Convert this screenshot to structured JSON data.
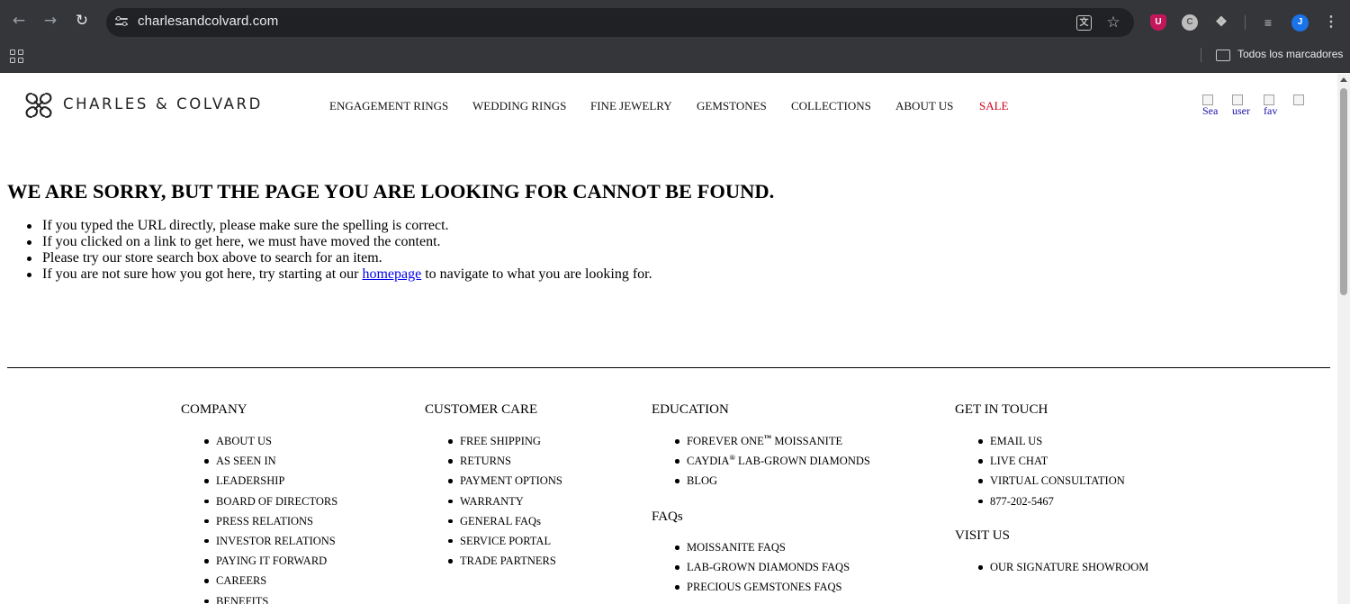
{
  "browser": {
    "url": "charlesandcolvard.com",
    "translate_glyph": "文",
    "bookmarks_folder_label": "Todos los marcadores",
    "profile_initial": "J",
    "extension_u_letter": "U",
    "extension_c_letter": "C"
  },
  "header": {
    "logo_text": "CHARLES & COLVARD",
    "nav": [
      "ENGAGEMENT RINGS",
      "WEDDING RINGS",
      "FINE JEWELRY",
      "GEMSTONES",
      "COLLECTIONS",
      "ABOUT US",
      "SALE"
    ],
    "icon_alts": [
      "Sea",
      "user",
      "fav",
      ""
    ]
  },
  "error": {
    "title": "WE ARE SORRY, BUT THE PAGE YOU ARE LOOKING FOR CANNOT BE FOUND.",
    "item_1": "If you typed the URL directly, please make sure the spelling is correct.",
    "item_2": "If you clicked on a link to get here, we must have moved the content.",
    "item_3": "Please try our store search box above to search for an item.",
    "item_4_before": "If you are not sure how you got here, try starting at our ",
    "item_4_link": "homepage",
    "item_4_after": " to navigate to what you are looking for."
  },
  "footer": {
    "company": {
      "heading": "COMPANY",
      "items": [
        "ABOUT US",
        "AS SEEN IN",
        "LEADERSHIP",
        "BOARD OF DIRECTORS",
        "PRESS RELATIONS",
        "INVESTOR RELATIONS",
        "PAYING IT FORWARD",
        "CAREERS",
        "BENEFITS"
      ]
    },
    "customer_care": {
      "heading": "CUSTOMER CARE",
      "items": [
        "FREE SHIPPING",
        "RETURNS",
        "PAYMENT OPTIONS",
        "WARRANTY",
        "GENERAL FAQs",
        "SERVICE PORTAL",
        "TRADE PARTNERS"
      ]
    },
    "education": {
      "heading": "EDUCATION",
      "forever_one_a": "FOREVER ONE",
      "forever_one_sup": "™",
      "forever_one_b": " MOISSANITE",
      "caydia_a": "CAYDIA",
      "caydia_sup": "®",
      "caydia_b": " LAB-GROWN DIAMONDS",
      "blog": "BLOG"
    },
    "faqs": {
      "heading": "FAQs",
      "items": [
        "MOISSANITE FAQS",
        "LAB-GROWN DIAMONDS FAQS",
        "PRECIOUS GEMSTONES FAQS"
      ]
    },
    "get_in_touch": {
      "heading": "GET IN TOUCH",
      "items": [
        "EMAIL US",
        "LIVE CHAT",
        "VIRTUAL CONSULTATION",
        "877-202-5467"
      ]
    },
    "visit_us": {
      "heading": "VISIT US",
      "items": [
        "OUR SIGNATURE SHOWROOM"
      ]
    }
  }
}
